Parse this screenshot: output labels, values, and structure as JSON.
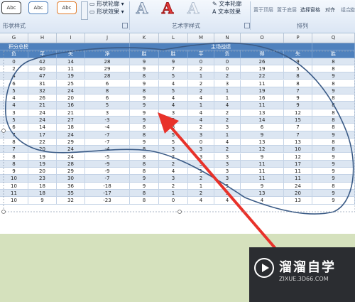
{
  "ribbon": {
    "shape_styles_label": "形状样式",
    "shape_outline": "形状轮廓",
    "shape_effects": "形状效果",
    "wordart_label": "艺术字样式",
    "text_outline": "文本轮廓",
    "text_effects": "文本效果",
    "arrange_label": "排列",
    "bring_front": "置于顶层",
    "send_back": "置于底层",
    "selection_pane": "选择窗格",
    "align": "对齐",
    "group": "组合",
    "rotate": "旋",
    "abc": "Abc",
    "bigA": "A"
  },
  "columns": [
    "G",
    "H",
    "I",
    "J",
    "K",
    "L",
    "M",
    "N",
    "O",
    "P",
    "Q"
  ],
  "group_headers": {
    "left": "积分总榜",
    "right": "主场战绩"
  },
  "field_headers": [
    "负",
    "平",
    "失",
    "净",
    "胜",
    "胜",
    "平",
    "负",
    "得",
    "失",
    "胜"
  ],
  "rows": [
    [
      "0",
      "42",
      "14",
      "28",
      "9",
      "9",
      "0",
      "0",
      "26",
      "9",
      "8"
    ],
    [
      "2",
      "40",
      "11",
      "29",
      "9",
      "7",
      "2",
      "0",
      "19",
      "5",
      "8"
    ],
    [
      "4",
      "47",
      "19",
      "28",
      "8",
      "5",
      "1",
      "2",
      "22",
      "8",
      "9"
    ],
    [
      "6",
      "31",
      "25",
      "6",
      "9",
      "4",
      "2",
      "3",
      "11",
      "8",
      "8"
    ],
    [
      "5",
      "32",
      "24",
      "8",
      "8",
      "5",
      "2",
      "1",
      "19",
      "7",
      "9"
    ],
    [
      "4",
      "26",
      "20",
      "6",
      "9",
      "4",
      "4",
      "1",
      "16",
      "9",
      "8"
    ],
    [
      "4",
      "21",
      "16",
      "5",
      "9",
      "4",
      "1",
      "4",
      "11",
      "9",
      "8"
    ],
    [
      "3",
      "24",
      "21",
      "3",
      "9",
      "3",
      "4",
      "2",
      "13",
      "12",
      "8"
    ],
    [
      "5",
      "24",
      "27",
      "-3",
      "9",
      "3",
      "4",
      "2",
      "14",
      "15",
      "8"
    ],
    [
      "6",
      "14",
      "18",
      "-4",
      "8",
      "3",
      "2",
      "3",
      "6",
      "7",
      "8"
    ],
    [
      "7",
      "17",
      "24",
      "-7",
      "8",
      "5",
      "3",
      "1",
      "9",
      "7",
      "9"
    ],
    [
      "8",
      "22",
      "29",
      "-7",
      "9",
      "5",
      "0",
      "4",
      "13",
      "13",
      "8"
    ],
    [
      "7",
      "20",
      "24",
      "-4",
      "8",
      "3",
      "3",
      "2",
      "12",
      "10",
      "8"
    ],
    [
      "8",
      "19",
      "24",
      "-5",
      "8",
      "2",
      "3",
      "3",
      "9",
      "12",
      "9"
    ],
    [
      "8",
      "19",
      "28",
      "-9",
      "8",
      "2",
      "3",
      "3",
      "11",
      "17",
      "9"
    ],
    [
      "9",
      "20",
      "29",
      "-9",
      "8",
      "4",
      "1",
      "3",
      "11",
      "11",
      "9"
    ],
    [
      "10",
      "23",
      "30",
      "-7",
      "9",
      "3",
      "2",
      "3",
      "11",
      "11",
      "9"
    ],
    [
      "10",
      "18",
      "36",
      "-18",
      "9",
      "2",
      "1",
      "5",
      "9",
      "24",
      "8"
    ],
    [
      "11",
      "18",
      "35",
      "-17",
      "8",
      "1",
      "2",
      "5",
      "13",
      "20",
      "9"
    ],
    [
      "10",
      "9",
      "32",
      "-23",
      "8",
      "0",
      "4",
      "4",
      "4",
      "13",
      "9"
    ]
  ],
  "watermark": {
    "title": "溜溜自学",
    "url": "ZIXUE.3D66.COM"
  },
  "colors": {
    "header_blue": "#4f81bd",
    "band": "#dce6f2",
    "arrow": "#e8322a",
    "freehand": "#3b5b86"
  }
}
